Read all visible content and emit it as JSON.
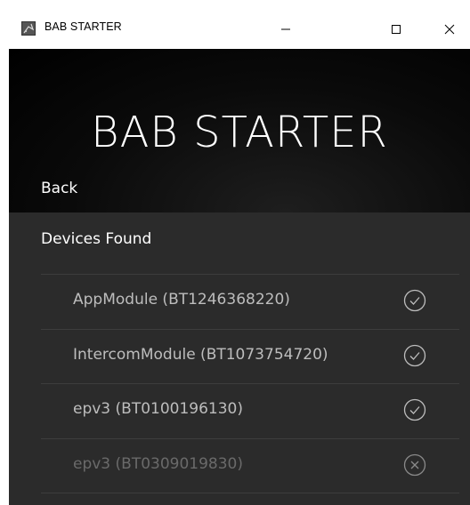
{
  "window": {
    "title": "BAB STARTER"
  },
  "header": {
    "title": "BAB STARTER",
    "back_label": "Back"
  },
  "devices": {
    "section_title": "Devices Found",
    "items": [
      {
        "label": "AppModule (BT1246368220)",
        "status": "connected",
        "icon": "check-circle-icon"
      },
      {
        "label": "IntercomModule (BT1073754720)",
        "status": "connected",
        "icon": "check-circle-icon"
      },
      {
        "label": "epv3 (BT0100196130)",
        "status": "connected",
        "icon": "check-circle-icon"
      },
      {
        "label": "epv3 (BT0309019830)",
        "status": "unavailable",
        "icon": "x-circle-icon"
      }
    ]
  },
  "colors": {
    "header_bg": "#000000",
    "content_bg": "#2b2b2b",
    "active_text": "#bdbdbd",
    "disabled_text": "#6a6a6a"
  }
}
